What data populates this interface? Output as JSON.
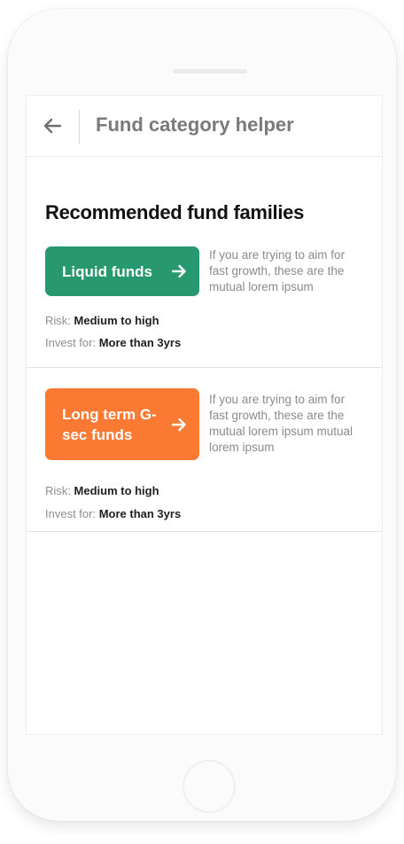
{
  "header": {
    "title": "Fund category helper"
  },
  "main": {
    "section_title": "Recommended fund families",
    "funds": [
      {
        "button_label": "Liquid funds",
        "description": "If you are trying to aim for fast growth, these are the mutual lorem ipsum",
        "risk_label": "Risk:",
        "risk_value": "Medium to high",
        "invest_label": "Invest for:",
        "invest_value": "More than 3yrs",
        "color": "#27986f"
      },
      {
        "button_label": "Long term G-sec funds",
        "description": "If you are trying to aim for fast growth, these are the mutual lorem ipsum mutual lorem ipsum",
        "risk_label": "Risk:",
        "risk_value": "Medium to high",
        "invest_label": "Invest for:",
        "invest_value": "More than 3yrs",
        "color": "#fa7a34"
      }
    ]
  },
  "icons": {
    "back": "arrow-left-icon",
    "fund_arrow": "arrow-right-icon"
  }
}
